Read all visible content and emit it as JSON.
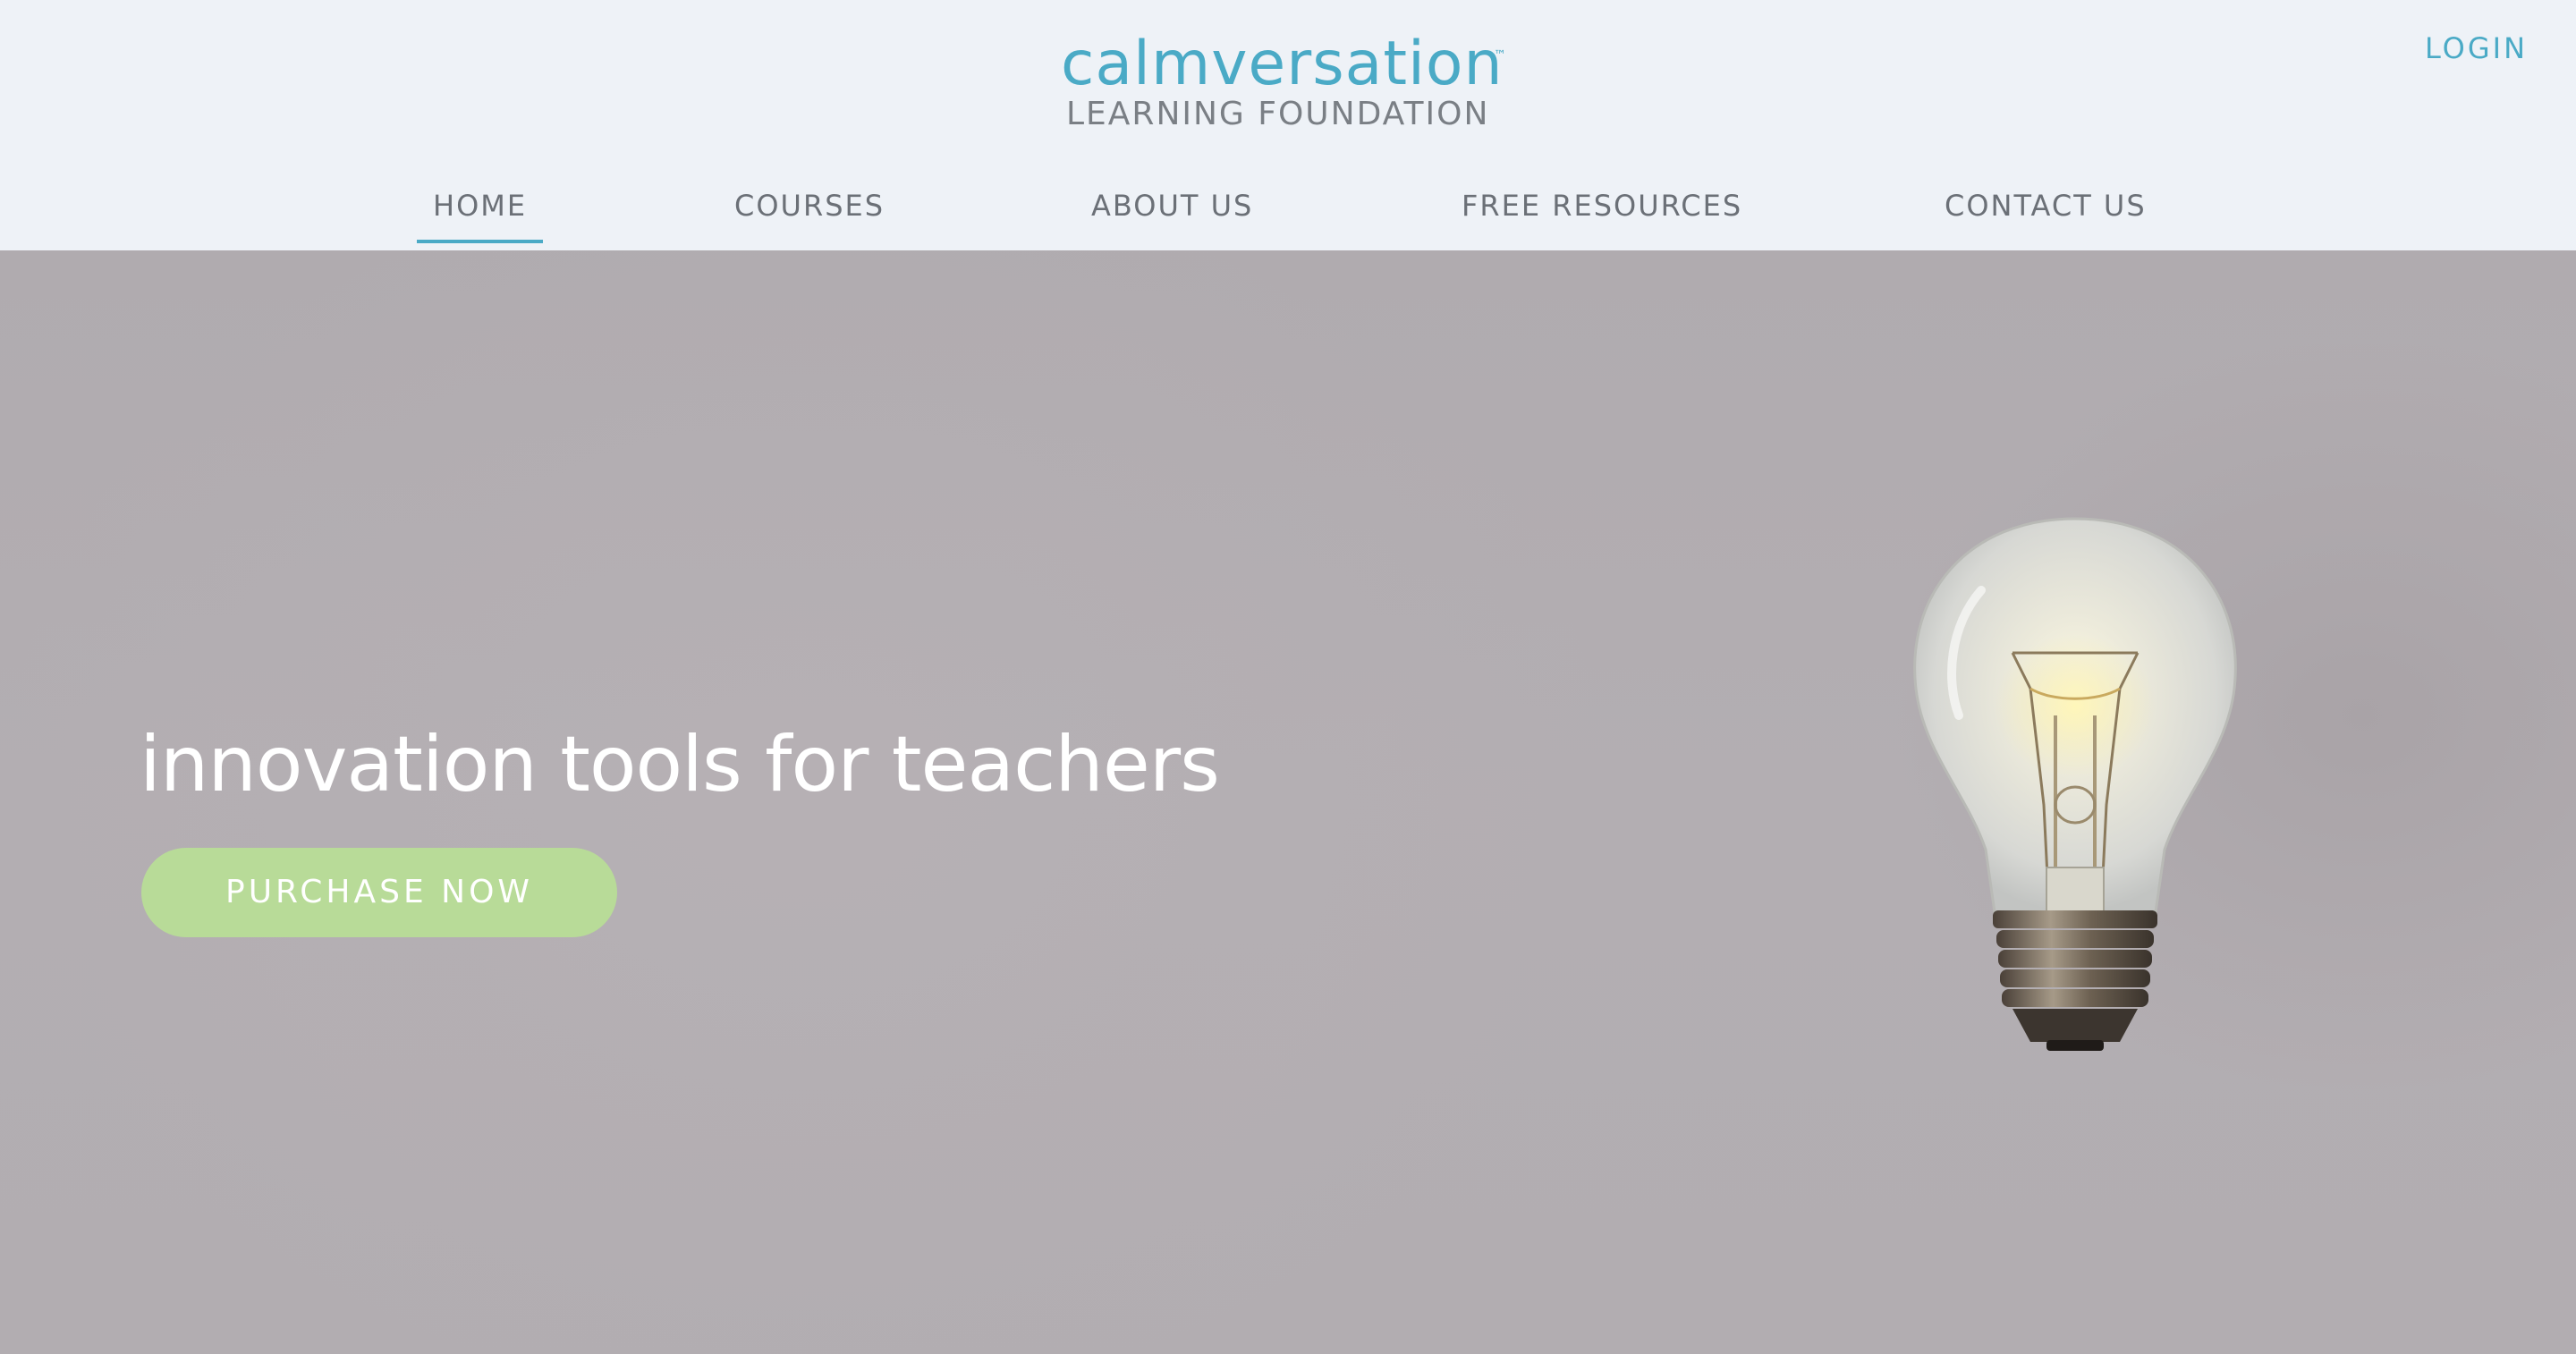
{
  "header": {
    "logo": {
      "name": "calmversation",
      "trademark": "™",
      "subtitle": "LEARNING FOUNDATION"
    },
    "login_label": "LOGIN",
    "nav": [
      {
        "label": "HOME",
        "active": true
      },
      {
        "label": "COURSES",
        "active": false
      },
      {
        "label": "ABOUT US",
        "active": false
      },
      {
        "label": "FREE RESOURCES",
        "active": false
      },
      {
        "label": "CONTACT US",
        "active": false
      }
    ]
  },
  "hero": {
    "title": "innovation tools for teachers",
    "cta_label": "PURCHASE NOW",
    "image": "light-bulb"
  },
  "colors": {
    "accent": "#4aaac6",
    "cta": "#b8db98",
    "header_bg": "#eef2f7",
    "hero_bg": "#b2adb1",
    "nav_text": "#6b7077"
  }
}
